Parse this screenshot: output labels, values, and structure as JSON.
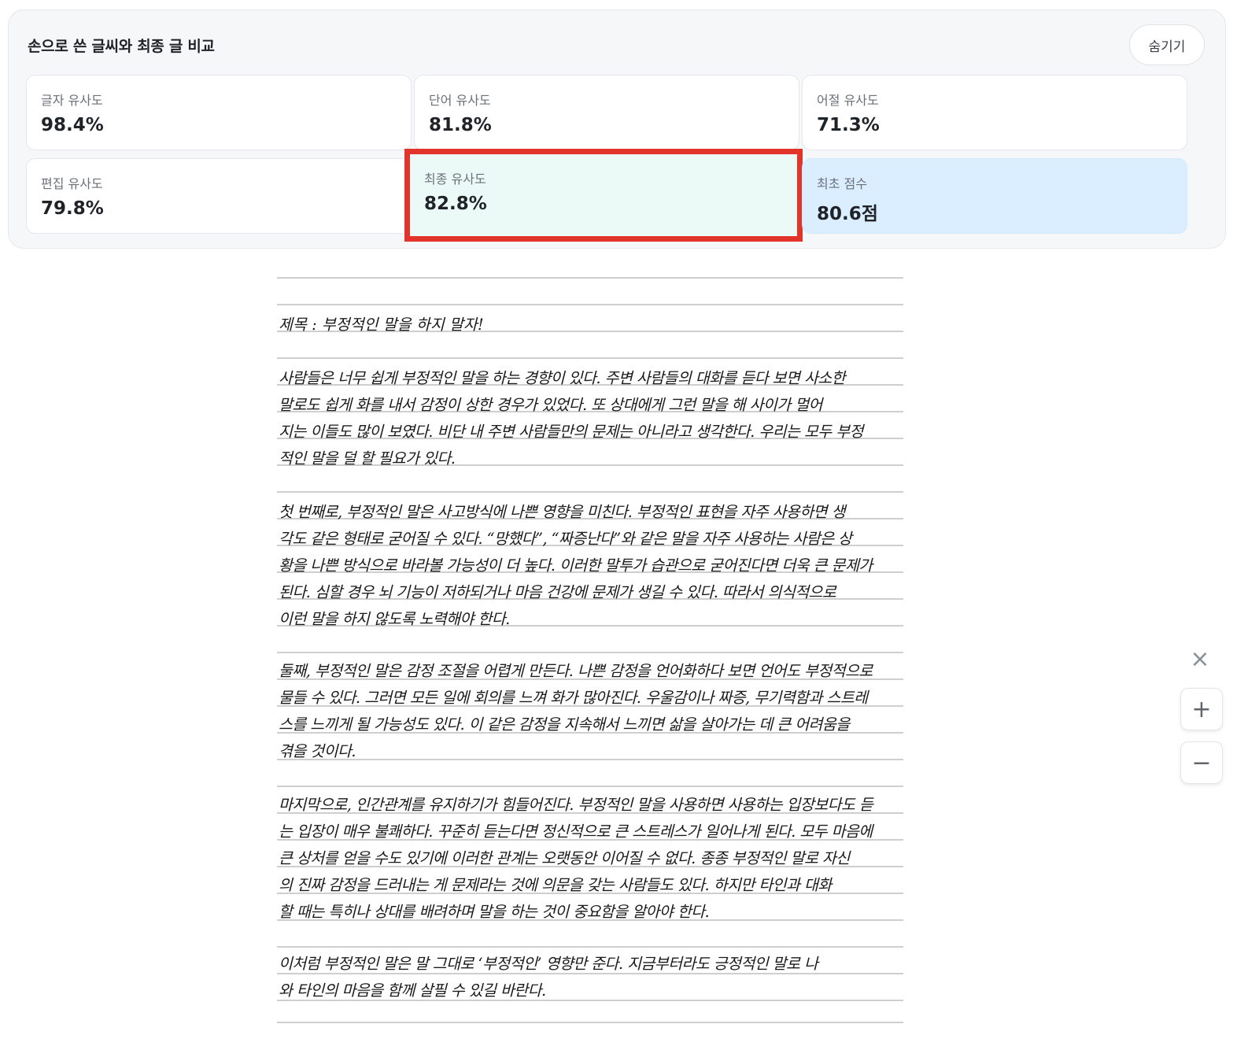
{
  "panel": {
    "title": "손으로 쓴 글씨와 최종 글 비교",
    "hide_label": "숨기기"
  },
  "metrics": [
    {
      "label": "글자 유사도",
      "value": "98.4%"
    },
    {
      "label": "단어 유사도",
      "value": "81.8%"
    },
    {
      "label": "어절 유사도",
      "value": "71.3%"
    },
    {
      "label": "편집 유사도",
      "value": "79.8%"
    },
    {
      "label": "최종 유사도",
      "value": "82.8%"
    },
    {
      "label": "최초 점수",
      "value": "80.6점"
    }
  ],
  "colors": {
    "highlight_border": "#e2342b",
    "final_card_bg": "#ecfaf7",
    "initial_card_bg": "#dbeeff"
  },
  "document": {
    "title": "제목 : 부정적인 말을 하지 말자!",
    "lines": [
      "사람들은 너무 쉽게 부정적인 말을 하는 경향이 있다. 주변 사람들의 대화를 듣다 보면 사소한",
      "말로도 쉽게 화를 내서 감정이 상한 경우가 있었다. 또 상대에게 그런 말을 해 사이가 멀어",
      "지는 이들도 많이 보였다. 비단 내 주변 사람들만의 문제는 아니라고 생각한다. 우리는 모두 부정",
      "적인 말을 덜 할 필요가 있다.",
      "첫 번째로, 부정적인 말은 사고방식에 나쁜 영향을 미친다. 부정적인 표현을 자주 사용하면 생",
      "각도 같은 형태로 굳어질 수 있다. “망했다”, “짜증난다”와 같은 말을 자주 사용하는 사람은 상",
      "황을 나쁜 방식으로 바라볼 가능성이 더 높다. 이러한 말투가 습관으로 굳어진다면 더욱 큰 문제가",
      "된다. 심할 경우 뇌 기능이 저하되거나 마음 건강에 문제가 생길 수 있다. 따라서 의식적으로",
      "이런 말을 하지 않도록 노력해야 한다.",
      "둘째, 부정적인 말은 감정 조절을 어렵게 만든다. 나쁜 감정을 언어화하다 보면 언어도 부정적으로",
      "물들 수 있다. 그러면 모든 일에 회의를 느껴 화가 많아진다. 우울감이나 짜증, 무기력함과 스트레",
      "스를 느끼게 될 가능성도 있다. 이 같은 감정을 지속해서 느끼면 삶을 살아가는 데 큰 어려움을",
      "겪을 것이다.",
      "마지막으로, 인간관계를 유지하기가 힘들어진다. 부정적인 말을 사용하면 사용하는 입장보다도 듣",
      "는 입장이 매우 불쾌하다. 꾸준히 듣는다면 정신적으로 큰 스트레스가 일어나게 된다. 모두 마음에",
      "큰 상처를 얻을 수도 있기에 이러한 관계는 오랫동안 이어질 수 없다. 종종 부정적인 말로 자신",
      "의 진짜 감정을 드러내는 게 문제라는 것에 의문을 갖는 사람들도 있다. 하지만 타인과 대화",
      "할 때는 특히나 상대를 배려하며 말을 하는 것이 중요함을 알아야 한다.",
      "이처럼 부정적인 말은 말 그대로 ‘부정적인’ 영향만 준다. 지금부터라도 긍정적인 말로 나",
      "와 타인의 마음을 함께 살필 수 있길 바란다."
    ]
  },
  "controls": {
    "close_glyph": "×",
    "zoom_in_glyph": "+",
    "zoom_out_glyph": "−"
  }
}
